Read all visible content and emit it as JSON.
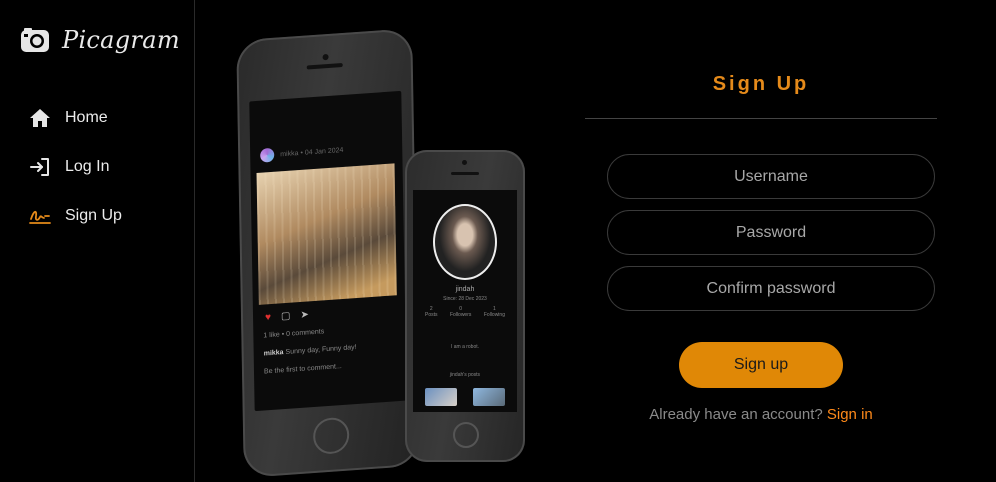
{
  "app": {
    "name": "Picagram"
  },
  "colors": {
    "accent": "#e08806",
    "title": "#e58a1a",
    "link": "#ff8a1a"
  },
  "sidebar": {
    "items": [
      {
        "label": "Home",
        "icon": "home-icon"
      },
      {
        "label": "Log In",
        "icon": "login-icon"
      },
      {
        "label": "Sign Up",
        "icon": "signature-icon"
      }
    ]
  },
  "phones": {
    "big": {
      "post_header": "mikka • 04 Jan 2024",
      "likes_line": "1 like • 0 comments",
      "caption_user": "mikka",
      "caption_text": "Sunny day, Funny day!",
      "comment_prompt": "Be the first to comment..."
    },
    "small": {
      "username": "jindah",
      "since": "Since: 28 Dec 2023",
      "stats": [
        {
          "count": "2",
          "label": "Posts"
        },
        {
          "count": "0",
          "label": "Followers"
        },
        {
          "count": "1",
          "label": "Following"
        }
      ],
      "bio": "I am a robot.",
      "posts_heading": "jindah's posts"
    }
  },
  "form": {
    "title": "Sign Up",
    "username_placeholder": "Username",
    "password_placeholder": "Password",
    "confirm_placeholder": "Confirm password",
    "submit_label": "Sign up",
    "alt_text": "Already have an account?",
    "alt_link": "Sign in"
  }
}
